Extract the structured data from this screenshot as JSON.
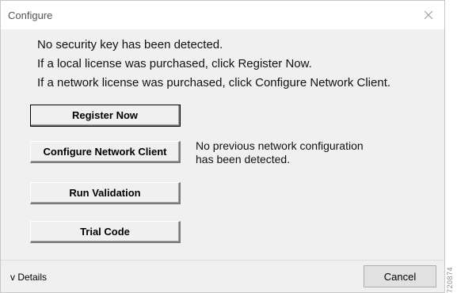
{
  "window": {
    "title": "Configure",
    "close_icon": "close-icon"
  },
  "messages": [
    "No security key has been detected.",
    "If a local license was purchased, click Register Now.",
    "If a network license was purchased, click Configure Network Client."
  ],
  "buttons": {
    "register": "Register Now",
    "configure_network": "Configure Network Client",
    "run_validation": "Run Validation",
    "trial_code": "Trial Code"
  },
  "network_note": {
    "line1": "No previous network configuration",
    "line2": "has been detected."
  },
  "footer": {
    "details_label": "v Details",
    "cancel_label": "Cancel"
  },
  "watermark": "720874"
}
